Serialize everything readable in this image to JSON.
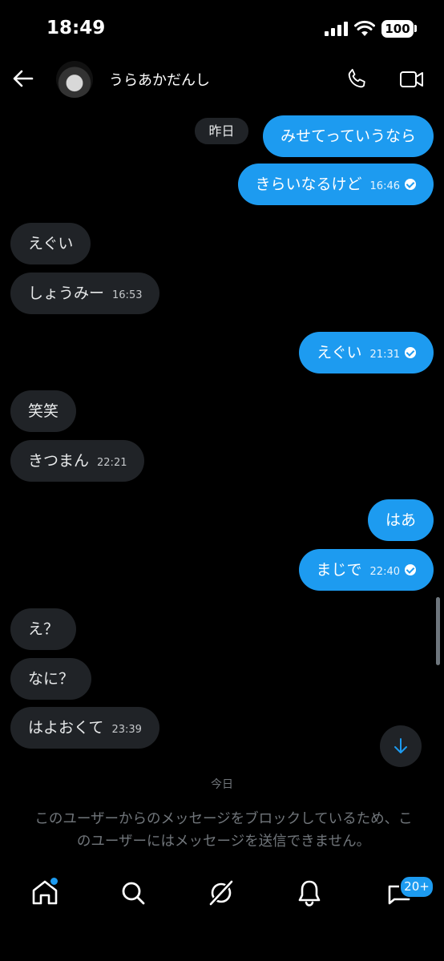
{
  "status_bar": {
    "time": "18:49",
    "battery": "100"
  },
  "header": {
    "title": "うらあかだんし"
  },
  "conversation": {
    "date_chip": "昨日",
    "messages": [
      {
        "dir": "out",
        "text": "みせてっていうなら",
        "time": ""
      },
      {
        "dir": "out",
        "text": "きらいなるけど",
        "time": "16:46"
      },
      {
        "dir": "in",
        "text": "えぐい",
        "time": ""
      },
      {
        "dir": "in",
        "text": "しょうみー",
        "time": "16:53"
      },
      {
        "dir": "out",
        "text": "えぐい",
        "time": "21:31"
      },
      {
        "dir": "in",
        "text": "笑笑",
        "time": ""
      },
      {
        "dir": "in",
        "text": "きつまん",
        "time": "22:21"
      },
      {
        "dir": "out",
        "text": "はあ",
        "time": ""
      },
      {
        "dir": "out",
        "text": "まじで",
        "time": "22:40"
      },
      {
        "dir": "in",
        "text": "え？",
        "time": ""
      },
      {
        "dir": "in",
        "text": "なに？",
        "time": ""
      },
      {
        "dir": "in",
        "text": "はよおくて",
        "time": "23:39"
      }
    ],
    "today_label": "今日",
    "blocked_notice": "このユーザーからのメッセージをブロックしているため、このユーザーにはメッセージを送信できません。"
  },
  "bottom_nav": {
    "messages_badge": "20+"
  },
  "colors": {
    "accent": "#1d9bf0",
    "incoming_bubble": "#202327",
    "background": "#000000"
  }
}
